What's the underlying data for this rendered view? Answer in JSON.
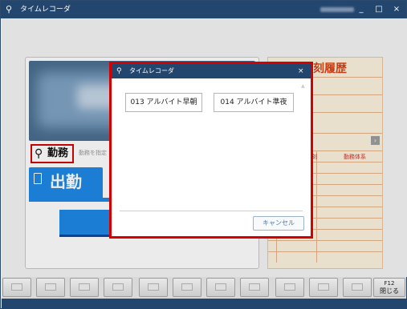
{
  "window": {
    "title": "タイムレコーダ",
    "title_icon": "person-plus-icon",
    "minimize": "_",
    "maximize": "□",
    "close": "×"
  },
  "left_panel": {
    "search_label": "勤務",
    "search_hint": "勤務を指定",
    "clock_in_label": "出勤"
  },
  "right_panel": {
    "title": "刻履歴",
    "col_time": "刻",
    "col_type": "勤務体系"
  },
  "function_keys": {
    "f12_key": "F12",
    "f12_label": "閉じる"
  },
  "dialog": {
    "title": "タイムレコーダ",
    "close": "×",
    "options": [
      "013 アルバイト早朝",
      "014 アルバイト準夜"
    ],
    "cancel_label": "キャンセル"
  },
  "colors": {
    "titlebar": "#22466e",
    "accent_blue": "#1e88e5",
    "highlight_red": "#d50000",
    "history_bg": "#fcf2df",
    "history_title": "#d84315"
  }
}
